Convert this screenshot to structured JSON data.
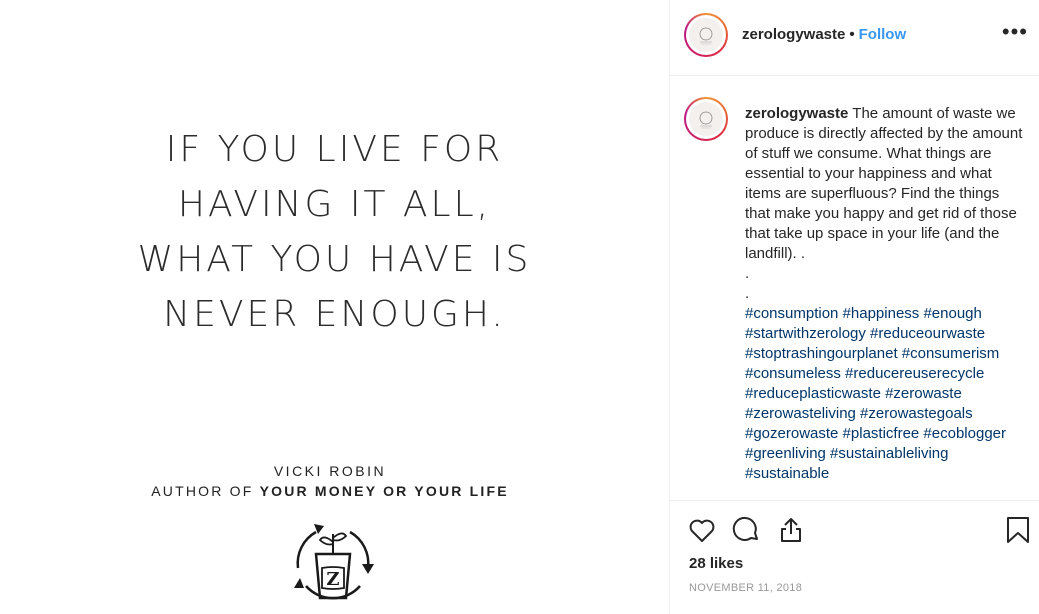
{
  "post_image": {
    "quote_lines": [
      "IF YOU LIVE FOR",
      "HAVING IT ALL,",
      "WHAT YOU HAVE IS",
      "NEVER ENOUGH."
    ],
    "author_name": "VICKI ROBIN",
    "author_prefix": "AUTHOR OF ",
    "author_book": "YOUR MONEY OR YOUR LIFE",
    "logo_letter": "Z"
  },
  "header": {
    "username": "zerologywaste",
    "separator": "•",
    "follow_label": "Follow",
    "more_label": "•••"
  },
  "caption": {
    "username": "zerologywaste",
    "text": "The amount of waste we produce is directly affected by the amount of stuff we consume. What things are essential to your happiness and what items are superfluous? Find the things that make you happy and get rid of those that take up space in your life (and the landfill). .",
    "dot1": ".",
    "dot2": ".",
    "hashtags": "#consumption #happiness #enough #startwithzerology #reduceourwaste #stoptrashingourplanet #consumerism #consumeless #reducereuserecycle #reduceplasticwaste #zerowaste #zerowasteliving #zerowastegoals #gozerowaste #plasticfree #ecoblogger #greenliving #sustainableliving #sustainable"
  },
  "actions": {
    "likes": "28 likes",
    "date": "NOVEMBER 11, 2018"
  },
  "icons": {
    "like": "heart-icon",
    "comment": "comment-icon",
    "share": "share-icon",
    "save": "bookmark-icon"
  },
  "colors": {
    "follow": "#3897f0",
    "hashtag": "#003569",
    "date": "#999999"
  }
}
